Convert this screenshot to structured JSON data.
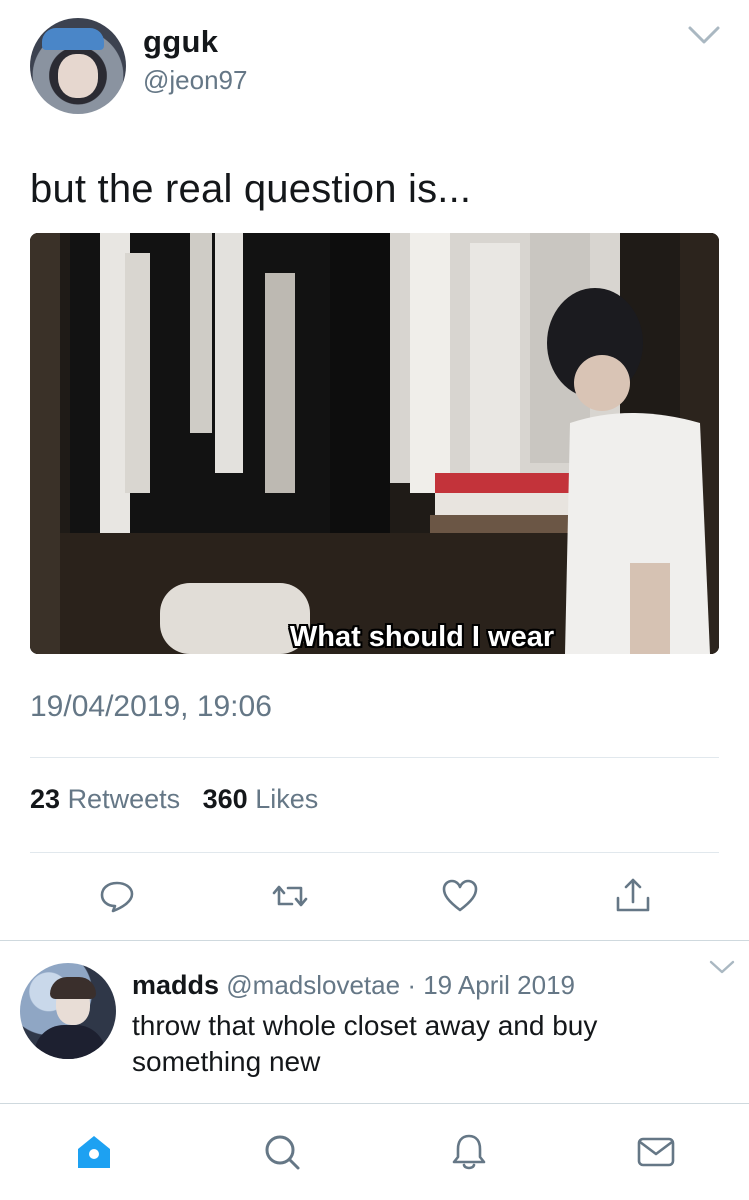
{
  "tweet": {
    "author_name": "gguk",
    "author_handle": "@jeon97",
    "text": "but the real question is...",
    "media_caption": "What should I wear",
    "timestamp": "19/04/2019, 19:06",
    "retweets_count": "23",
    "retweets_label": "Retweets",
    "likes_count": "360",
    "likes_label": "Likes"
  },
  "actions": [
    "reply-icon",
    "retweet-icon",
    "like-icon",
    "share-icon"
  ],
  "reply": {
    "author_name": "madds",
    "author_handle": "@madslovetae",
    "separator": "·",
    "date": "19 April 2019",
    "text": "throw that whole closet away and buy something new"
  },
  "tabbar": {
    "items": [
      "home-icon",
      "search-icon",
      "notifications-icon",
      "messages-icon"
    ],
    "active_color": "#1da1f2",
    "inactive_color": "#657786"
  },
  "colors": {
    "text_primary": "#14171a",
    "text_secondary": "#657786",
    "divider": "#e1e8ed",
    "accent": "#1da1f2"
  }
}
